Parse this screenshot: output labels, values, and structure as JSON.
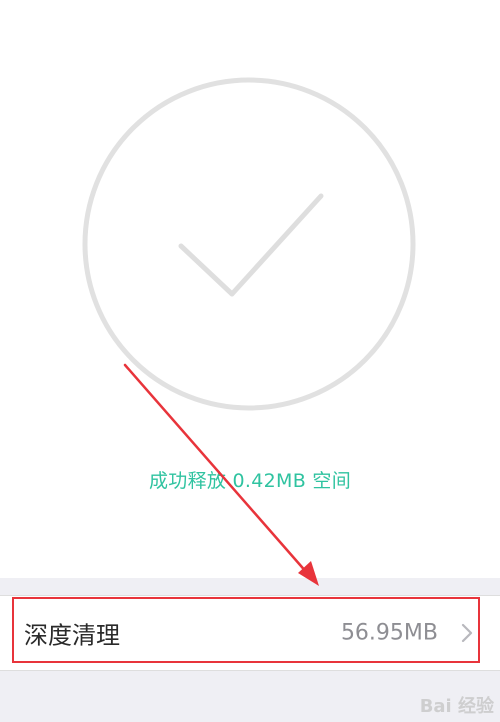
{
  "result": {
    "success_message": "成功释放 0.42MB 空间",
    "accent_color": "#2fc3a0",
    "status_icon": "checkmark-icon"
  },
  "deep_clean": {
    "label": "深度清理",
    "size": "56.95MB",
    "chevron_icon": "chevron-right-icon"
  },
  "watermark": {
    "text": "Bai 经验"
  }
}
